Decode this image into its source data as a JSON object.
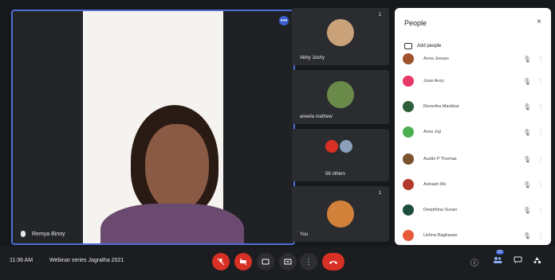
{
  "main_tile": {
    "participant_name": "Remya Binoy",
    "menu_label": "•••"
  },
  "side_tiles": [
    {
      "name": "Abhy Joshy",
      "count": "1"
    },
    {
      "name": "aneela mathew",
      "count": ""
    },
    {
      "name": "56 others",
      "count": ""
    },
    {
      "name": "You",
      "count": "1"
    }
  ],
  "people_panel": {
    "title": "People",
    "close_label": "×",
    "add_people_label": "Add people",
    "rows": [
      {
        "name": "Anna Jossan",
        "avatar_color": "#a0522d"
      },
      {
        "name": "Jossi Anzy",
        "avatar_color": "#e6396a"
      },
      {
        "name": "Revertha Mankkar",
        "avatar_color": "#2e5e3a"
      },
      {
        "name": "Arvis Joji",
        "avatar_color": "#4caf50"
      },
      {
        "name": "Austin P Thomas",
        "avatar_color": "#7a5230"
      },
      {
        "name": "Avinash Ms",
        "avatar_color": "#b23a2a"
      },
      {
        "name": "Deepthina Susan",
        "avatar_color": "#1f4d3b"
      },
      {
        "name": "Ushna Raghavan",
        "avatar_color": "#e85a3a"
      }
    ],
    "mic_off_icon": "🎙︎",
    "more_icon": "⋮"
  },
  "bottom_bar": {
    "time": "11:36 AM",
    "meeting_title": "Webinar series Jagratha 2021",
    "people_count": "62"
  }
}
